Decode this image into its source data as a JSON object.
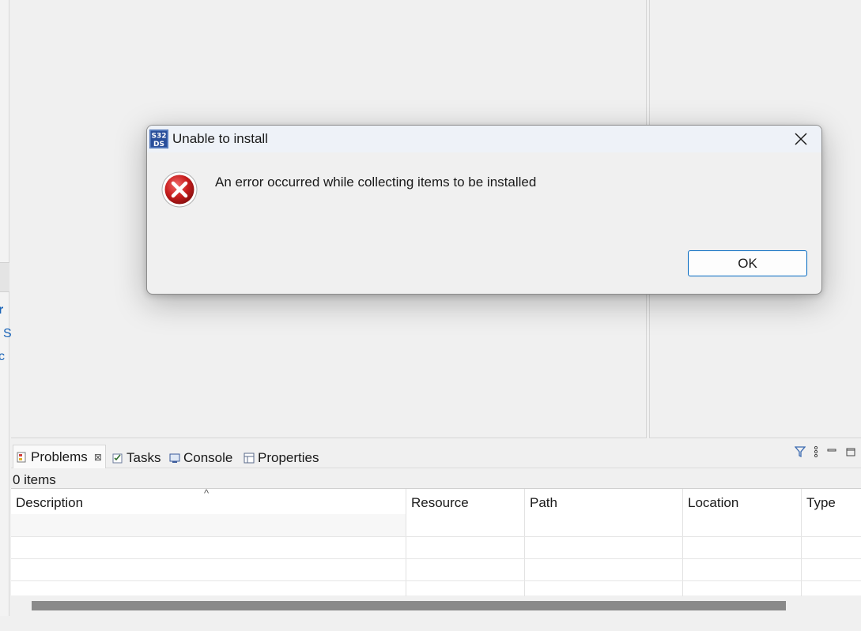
{
  "dialog": {
    "title": "Unable to install",
    "message": "An error occurred while collecting items to be installed",
    "ok_label": "OK",
    "app_icon": "s32ds-icon",
    "app_icon_text": "S32\nDS",
    "error_icon": "error-x-icon"
  },
  "left_panel_fragments": [
    "r",
    "S",
    "c"
  ],
  "problems_view": {
    "tabs": [
      {
        "label": "Problems",
        "icon": "problems-icon",
        "active": true
      },
      {
        "label": "Tasks",
        "icon": "tasks-icon",
        "active": false
      },
      {
        "label": "Console",
        "icon": "console-icon",
        "active": false
      },
      {
        "label": "Properties",
        "icon": "properties-icon",
        "active": false
      }
    ],
    "item_count": "0 items",
    "columns": [
      "Description",
      "Resource",
      "Path",
      "Location",
      "Type"
    ],
    "tools": [
      "filter-icon",
      "view-menu-icon",
      "minimize-icon",
      "maximize-icon"
    ]
  },
  "colors": {
    "accent": "#0067c0",
    "error_red": "#c81e1e",
    "link_blue": "#1a64b8"
  }
}
